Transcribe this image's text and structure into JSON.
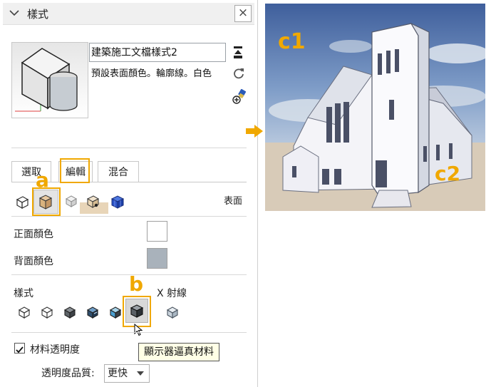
{
  "panel": {
    "title": "樣式",
    "close_glyph": "×",
    "style_name": "建築施工文檔樣式2",
    "style_description": "預設表面顏色。輪廓線。白色"
  },
  "tabs": [
    {
      "label": "選取"
    },
    {
      "label": "編輯"
    },
    {
      "label": "混合"
    }
  ],
  "face_settings": {
    "section_label": "表面",
    "front_color_label": "正面顏色",
    "back_color_label": "背面顏色",
    "front_color": "#ffffff",
    "back_color": "#a9b2bb"
  },
  "style_section": {
    "label": "樣式",
    "xray_label": "X 射線",
    "selected_style": "顯示器逼真材料"
  },
  "transparency": {
    "checkbox_label": "材料透明度",
    "checked": true,
    "quality_label": "透明度品質:",
    "quality_value": "更快"
  },
  "tooltip": {
    "text": "顯示器逼真材料"
  },
  "callouts": {
    "a": "a",
    "b": "b",
    "c1": "c1",
    "c2": "c2"
  },
  "colors": {
    "highlight": "#f0a800",
    "accent_blue": "#1a62c8"
  }
}
